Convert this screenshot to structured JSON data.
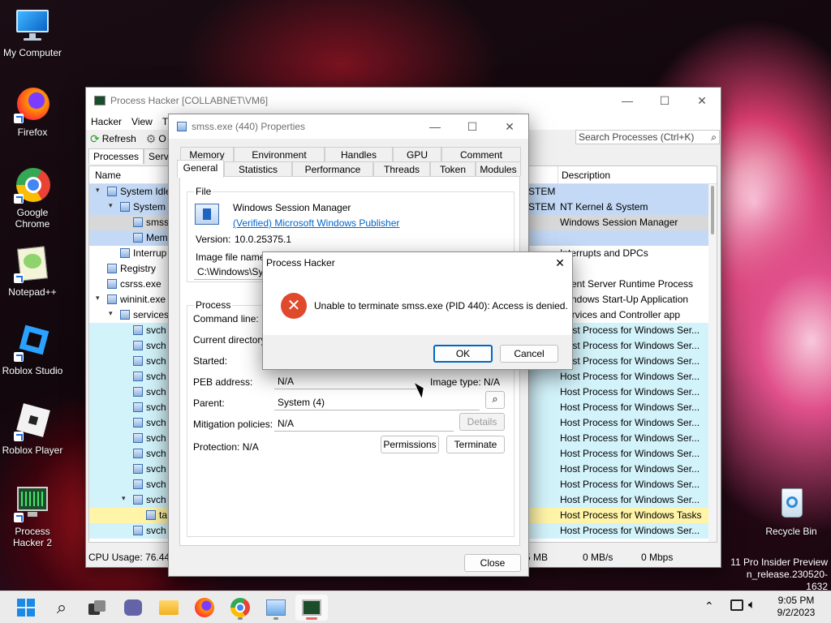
{
  "desktop_icons": [
    {
      "label": "My Computer",
      "icon": "monitor-icon"
    },
    {
      "label": "Firefox",
      "icon": "firefox-icon"
    },
    {
      "label": "Google Chrome",
      "icon": "chrome-icon"
    },
    {
      "label": "Notepad++",
      "icon": "notepadpp-icon"
    },
    {
      "label": "Roblox Studio",
      "icon": "roblox-studio-icon"
    },
    {
      "label": "Roblox Player",
      "icon": "roblox-player-icon"
    },
    {
      "label": "Process Hacker 2",
      "icon": "process-hacker-icon"
    },
    {
      "label": "Recycle Bin",
      "icon": "recycle-bin-icon"
    }
  ],
  "watermark": {
    "line1": "11 Pro Insider Preview",
    "line2": "n_release.230520-1632"
  },
  "main_window": {
    "title": "Process Hacker [COLLABNET\\VM6]",
    "menu": [
      "Hacker",
      "View",
      "T"
    ],
    "toolbar": {
      "refresh": "Refresh",
      "options_partial": "O"
    },
    "search_placeholder": "Search Processes (Ctrl+K)",
    "tabs": [
      "Processes",
      "Service"
    ],
    "columns": {
      "name": "Name",
      "description": "Description"
    },
    "rows": [
      {
        "name": "System Idle",
        "user": "STEM",
        "desc": "",
        "bg": "#c3d9f5",
        "indent": 0,
        "twisty": "▾"
      },
      {
        "name": "System",
        "user": "STEM",
        "desc": "NT Kernel & System",
        "bg": "#c3d9f5",
        "indent": 1,
        "twisty": "▾"
      },
      {
        "name": "smss",
        "user": "",
        "desc": "Windows Session Manager",
        "bg": "#d8d8d8",
        "indent": 2,
        "twisty": ""
      },
      {
        "name": "Mem",
        "user": "",
        "desc": "",
        "bg": "#c3d9f5",
        "indent": 2,
        "twisty": ""
      },
      {
        "name": "Interrup",
        "user": "",
        "desc": "Interrupts and DPCs",
        "bg": "#ffffff",
        "indent": 1,
        "twisty": ""
      },
      {
        "name": "Registry",
        "user": "",
        "desc": "",
        "bg": "#ffffff",
        "indent": 0,
        "twisty": ""
      },
      {
        "name": "csrss.exe",
        "user": "",
        "desc": "Client Server Runtime Process",
        "bg": "#ffffff",
        "indent": 0,
        "twisty": ""
      },
      {
        "name": "wininit.exe",
        "user": "",
        "desc": "Windows Start-Up Application",
        "bg": "#ffffff",
        "indent": 0,
        "twisty": "▾"
      },
      {
        "name": "services",
        "user": "",
        "desc": "Services and Controller app",
        "bg": "#ffffff",
        "indent": 1,
        "twisty": "▾"
      },
      {
        "name": "svch",
        "user": "",
        "desc": "Host Process for Windows Ser...",
        "bg": "#d3f3fb",
        "indent": 2,
        "twisty": ""
      },
      {
        "name": "svch",
        "user": "",
        "desc": "Host Process for Windows Ser...",
        "bg": "#d3f3fb",
        "indent": 2,
        "twisty": ""
      },
      {
        "name": "svch",
        "user": "",
        "desc": "Host Process for Windows Ser...",
        "bg": "#d3f3fb",
        "indent": 2,
        "twisty": ""
      },
      {
        "name": "svch",
        "user": "",
        "desc": "Host Process for Windows Ser...",
        "bg": "#d3f3fb",
        "indent": 2,
        "twisty": ""
      },
      {
        "name": "svch",
        "user": "",
        "desc": "Host Process for Windows Ser...",
        "bg": "#d3f3fb",
        "indent": 2,
        "twisty": ""
      },
      {
        "name": "svch",
        "user": "",
        "desc": "Host Process for Windows Ser...",
        "bg": "#d3f3fb",
        "indent": 2,
        "twisty": ""
      },
      {
        "name": "svch",
        "user": "",
        "desc": "Host Process for Windows Ser...",
        "bg": "#d3f3fb",
        "indent": 2,
        "twisty": ""
      },
      {
        "name": "svch",
        "user": "",
        "desc": "Host Process for Windows Ser...",
        "bg": "#d3f3fb",
        "indent": 2,
        "twisty": ""
      },
      {
        "name": "svch",
        "user": "",
        "desc": "Host Process for Windows Ser...",
        "bg": "#d3f3fb",
        "indent": 2,
        "twisty": ""
      },
      {
        "name": "svch",
        "user": "",
        "desc": "Host Process for Windows Ser...",
        "bg": "#d3f3fb",
        "indent": 2,
        "twisty": ""
      },
      {
        "name": "svch",
        "user": "",
        "desc": "Host Process for Windows Ser...",
        "bg": "#d3f3fb",
        "indent": 2,
        "twisty": ""
      },
      {
        "name": "svch",
        "user": "",
        "desc": "Host Process for Windows Ser...",
        "bg": "#d3f3fb",
        "indent": 2,
        "twisty": "▾"
      },
      {
        "name": "ta",
        "user": "",
        "desc": "Host Process for Windows Tasks",
        "bg": "#fff4a8",
        "indent": 3,
        "twisty": ""
      },
      {
        "name": "svch",
        "user": "",
        "desc": "Host Process for Windows Ser...",
        "bg": "#d3f3fb",
        "indent": 2,
        "twisty": ""
      }
    ],
    "status": {
      "cpu": "CPU Usage: 76.44%",
      "mem": "5 MB",
      "io": "0 MB/s",
      "net": "0 Mbps"
    }
  },
  "props_window": {
    "title": "smss.exe (440) Properties",
    "tabs_top": [
      "Memory",
      "Environment",
      "Handles",
      "GPU",
      "Comment"
    ],
    "tabs_bottom": [
      "General",
      "Statistics",
      "Performance",
      "Threads",
      "Token",
      "Modules"
    ],
    "file_group": "File",
    "description": "Windows Session Manager",
    "publisher_link": "(Verified) Microsoft Windows Publisher",
    "version_label": "Version:",
    "version": "10.0.25375.1",
    "image_file_label": "Image file name:",
    "image_file": "C:\\Windows\\Sys",
    "process_group": "Process",
    "command_line_label": "Command line:",
    "current_dir_label": "Current directory:",
    "started_label": "Started:",
    "peb_label": "PEB address:",
    "peb_value": "N/A",
    "image_type": "Image type:  N/A",
    "parent_label": "Parent:",
    "parent_value": "System (4)",
    "mitigation_label": "Mitigation policies:",
    "mitigation_value": "N/A",
    "details_btn": "Details",
    "protection": "Protection:  N/A",
    "permissions_btn": "Permissions",
    "terminate_btn": "Terminate",
    "close_btn": "Close"
  },
  "message_box": {
    "title": "Process Hacker",
    "text": "Unable to terminate smss.exe (PID 440): Access is denied.",
    "ok": "OK",
    "cancel": "Cancel"
  },
  "taskbar": {
    "apps": [
      "start-icon",
      "search-icon",
      "task-view-icon",
      "chat-icon",
      "file-explorer-icon",
      "firefox-icon",
      "chrome-icon",
      "task-manager-icon",
      "process-hacker-icon"
    ],
    "time": "9:05 PM",
    "date": "9/2/2023"
  }
}
